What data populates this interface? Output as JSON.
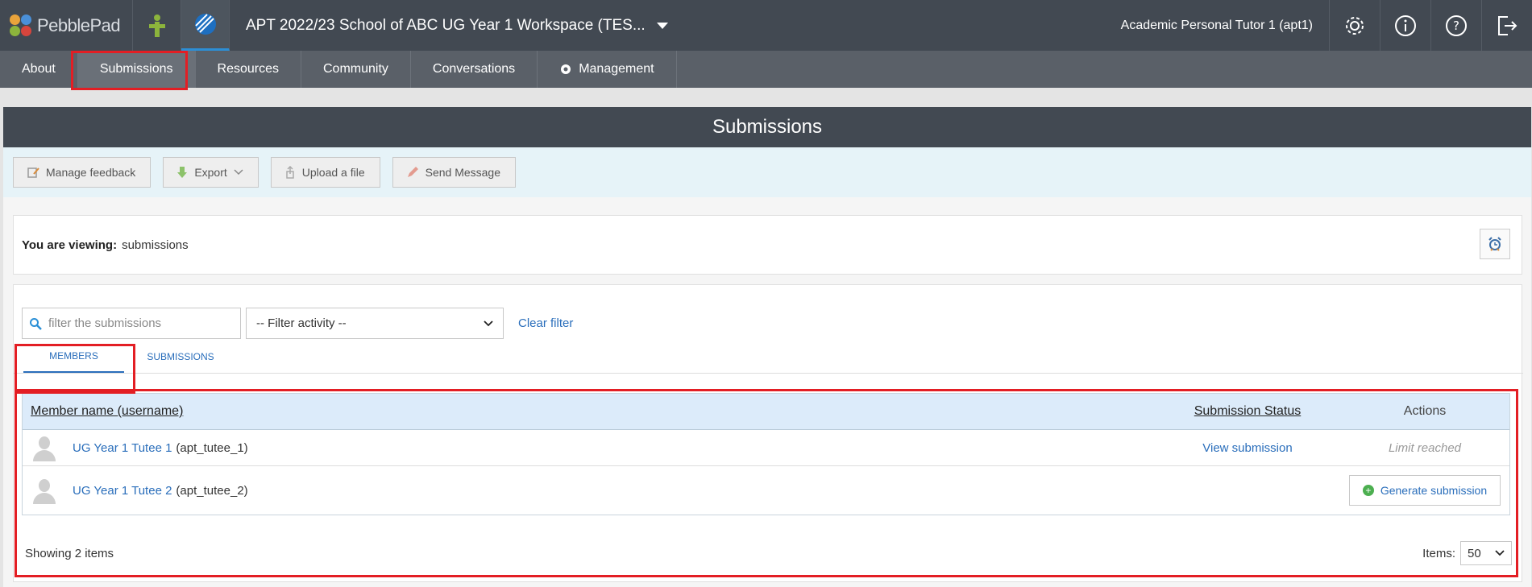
{
  "app": {
    "brand": "PebblePad",
    "workspace_title": "APT 2022/23 School of ABC UG Year 1 Workspace (TES...",
    "user": "Academic Personal Tutor 1 (apt1)"
  },
  "nav": {
    "items": [
      {
        "label": "About"
      },
      {
        "label": "Submissions"
      },
      {
        "label": "Resources"
      },
      {
        "label": "Community"
      },
      {
        "label": "Conversations"
      },
      {
        "label": "Management"
      }
    ]
  },
  "page": {
    "title": "Submissions"
  },
  "toolbar": {
    "manage_feedback": "Manage feedback",
    "export": "Export",
    "upload": "Upload a file",
    "send_message": "Send Message"
  },
  "viewing": {
    "label": "You are viewing:",
    "value": "submissions"
  },
  "filters": {
    "search_placeholder": "filter the submissions",
    "activity_selected": "-- Filter activity --",
    "clear": "Clear filter"
  },
  "tabs": {
    "members": "MEMBERS",
    "submissions": "SUBMISSIONS"
  },
  "table": {
    "headers": {
      "name": "Member name (username)",
      "status": "Submission Status",
      "actions": "Actions"
    },
    "rows": [
      {
        "name": "UG Year 1 Tutee 1",
        "username": "(apt_tutee_1)",
        "status": "View submission",
        "action": "Limit reached"
      },
      {
        "name": "UG Year 1 Tutee 2",
        "username": "(apt_tutee_2)",
        "status": "",
        "action": "Generate submission"
      }
    ]
  },
  "footer": {
    "showing": "Showing 2 items",
    "items_label": "Items:",
    "items_value": "50"
  },
  "colors": {
    "topbar": "#424952",
    "navbar": "#5a6068",
    "accent": "#2a6ebb",
    "highlight": "#e31e24"
  }
}
